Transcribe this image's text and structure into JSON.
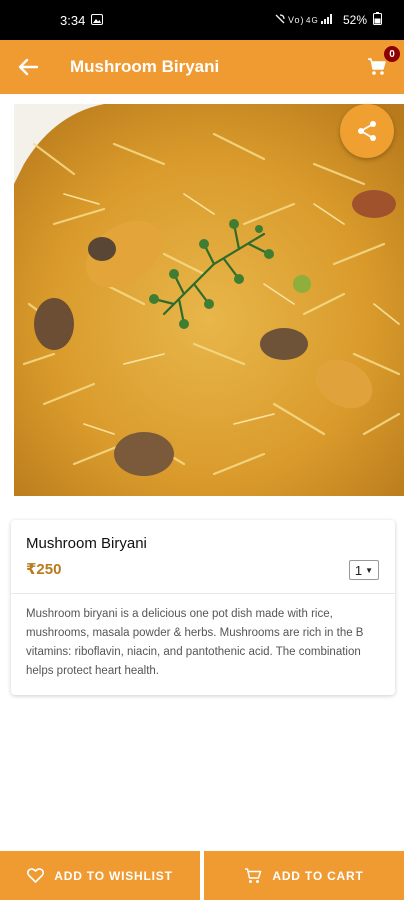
{
  "status_bar": {
    "time": "3:34",
    "battery": "52%"
  },
  "app_bar": {
    "title": "Mushroom Biryani",
    "cart_count": "0"
  },
  "image": {
    "alt": "Mushroom Biryani"
  },
  "product": {
    "name": "Mushroom Biryani",
    "price": "₹250",
    "quantity": "1",
    "description": "Mushroom biryani is a delicious one pot dish made with rice, mushrooms, masala powder & herbs. Mushrooms are rich in the B vitamins: riboflavin, niacin, and pantothenic acid. The combination helps protect heart health."
  },
  "actions": {
    "wishlist_label": "ADD TO WISHLIST",
    "cart_label": "ADD TO CART"
  },
  "colors": {
    "accent": "#f09a32",
    "price": "#b87a1c",
    "badge": "#8b0000"
  }
}
